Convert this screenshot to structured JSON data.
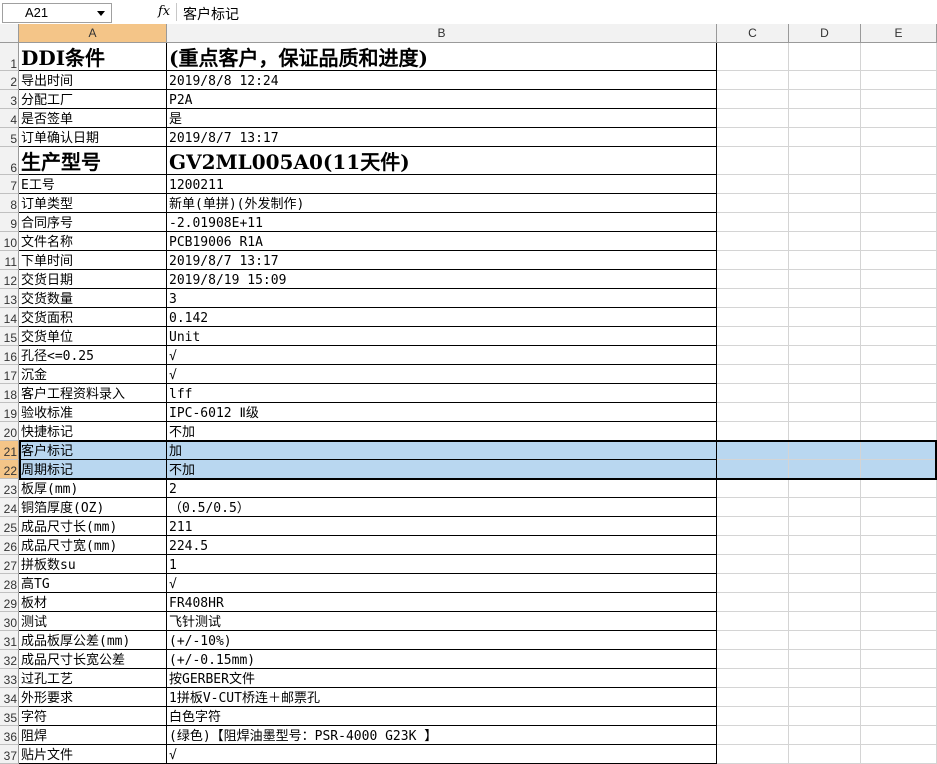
{
  "formula_bar": {
    "name_box": "A21",
    "fx_label": "fx",
    "content": "客户标记"
  },
  "columns": [
    "A",
    "B",
    "C",
    "D",
    "E"
  ],
  "rows": [
    {
      "num": "1",
      "a": "DDI条件",
      "b": "(重点客户，保证品质和进度)",
      "style": "big"
    },
    {
      "num": "2",
      "a": "导出时间",
      "b": "2019/8/8 12:24"
    },
    {
      "num": "3",
      "a": "分配工厂",
      "b": "P2A"
    },
    {
      "num": "4",
      "a": "是否签单",
      "b": "是"
    },
    {
      "num": "5",
      "a": "订单确认日期",
      "b": "2019/8/7 13:17"
    },
    {
      "num": "6",
      "a": "生产型号",
      "b": "GV2ML005A0(11天件)",
      "style": "big"
    },
    {
      "num": "7",
      "a": "E工号",
      "b": "1200211"
    },
    {
      "num": "8",
      "a": "订单类型",
      "b": "新单(单拼)(外发制作)"
    },
    {
      "num": "9",
      "a": "合同序号",
      "b": "-2.01908E+11"
    },
    {
      "num": "10",
      "a": "文件名称",
      "b": "PCB19006 R1A"
    },
    {
      "num": "11",
      "a": "下单时间",
      "b": "2019/8/7 13:17"
    },
    {
      "num": "12",
      "a": "交货日期",
      "b": "2019/8/19 15:09"
    },
    {
      "num": "13",
      "a": "交货数量",
      "b": "3"
    },
    {
      "num": "14",
      "a": "交货面积",
      "b": "0.142"
    },
    {
      "num": "15",
      "a": "交货单位",
      "b": "Unit"
    },
    {
      "num": "16",
      "a": "孔径<=0.25",
      "b": "√"
    },
    {
      "num": "17",
      "a": "沉金",
      "b": "√"
    },
    {
      "num": "18",
      "a": "客户工程资料录入",
      "b": "lff"
    },
    {
      "num": "19",
      "a": "验收标准",
      "b": "IPC-6012 Ⅱ级"
    },
    {
      "num": "20",
      "a": "快捷标记",
      "b": "不加"
    },
    {
      "num": "21",
      "a": "客户标记",
      "b": "加",
      "selected": true
    },
    {
      "num": "22",
      "a": "周期标记",
      "b": "不加",
      "selected": true
    },
    {
      "num": "23",
      "a": "板厚(mm)",
      "b": "2"
    },
    {
      "num": "24",
      "a": "铜箔厚度(OZ)",
      "b": "（0.5/0.5）"
    },
    {
      "num": "25",
      "a": "成品尺寸长(mm)",
      "b": "211"
    },
    {
      "num": "26",
      "a": "成品尺寸宽(mm)",
      "b": "224.5"
    },
    {
      "num": "27",
      "a": "拼板数su",
      "b": "1"
    },
    {
      "num": "28",
      "a": "高TG",
      "b": "√"
    },
    {
      "num": "29",
      "a": "板材",
      "b": "FR408HR"
    },
    {
      "num": "30",
      "a": "测试",
      "b": "飞针测试"
    },
    {
      "num": "31",
      "a": "成品板厚公差(mm)",
      "b": "(+/-10%)"
    },
    {
      "num": "32",
      "a": "成品尺寸长宽公差",
      "b": "(+/-0.15mm)"
    },
    {
      "num": "33",
      "a": "过孔工艺",
      "b": "按GERBER文件"
    },
    {
      "num": "34",
      "a": "外形要求",
      "b": "1拼板V-CUT桥连＋邮票孔"
    },
    {
      "num": "35",
      "a": "字符",
      "b": "白色字符"
    },
    {
      "num": "36",
      "a": "阻焊",
      "b": "(绿色)【阻焊油墨型号：PSR-4000 G23K 】"
    },
    {
      "num": "37",
      "a": "贴片文件",
      "b": "√"
    }
  ]
}
